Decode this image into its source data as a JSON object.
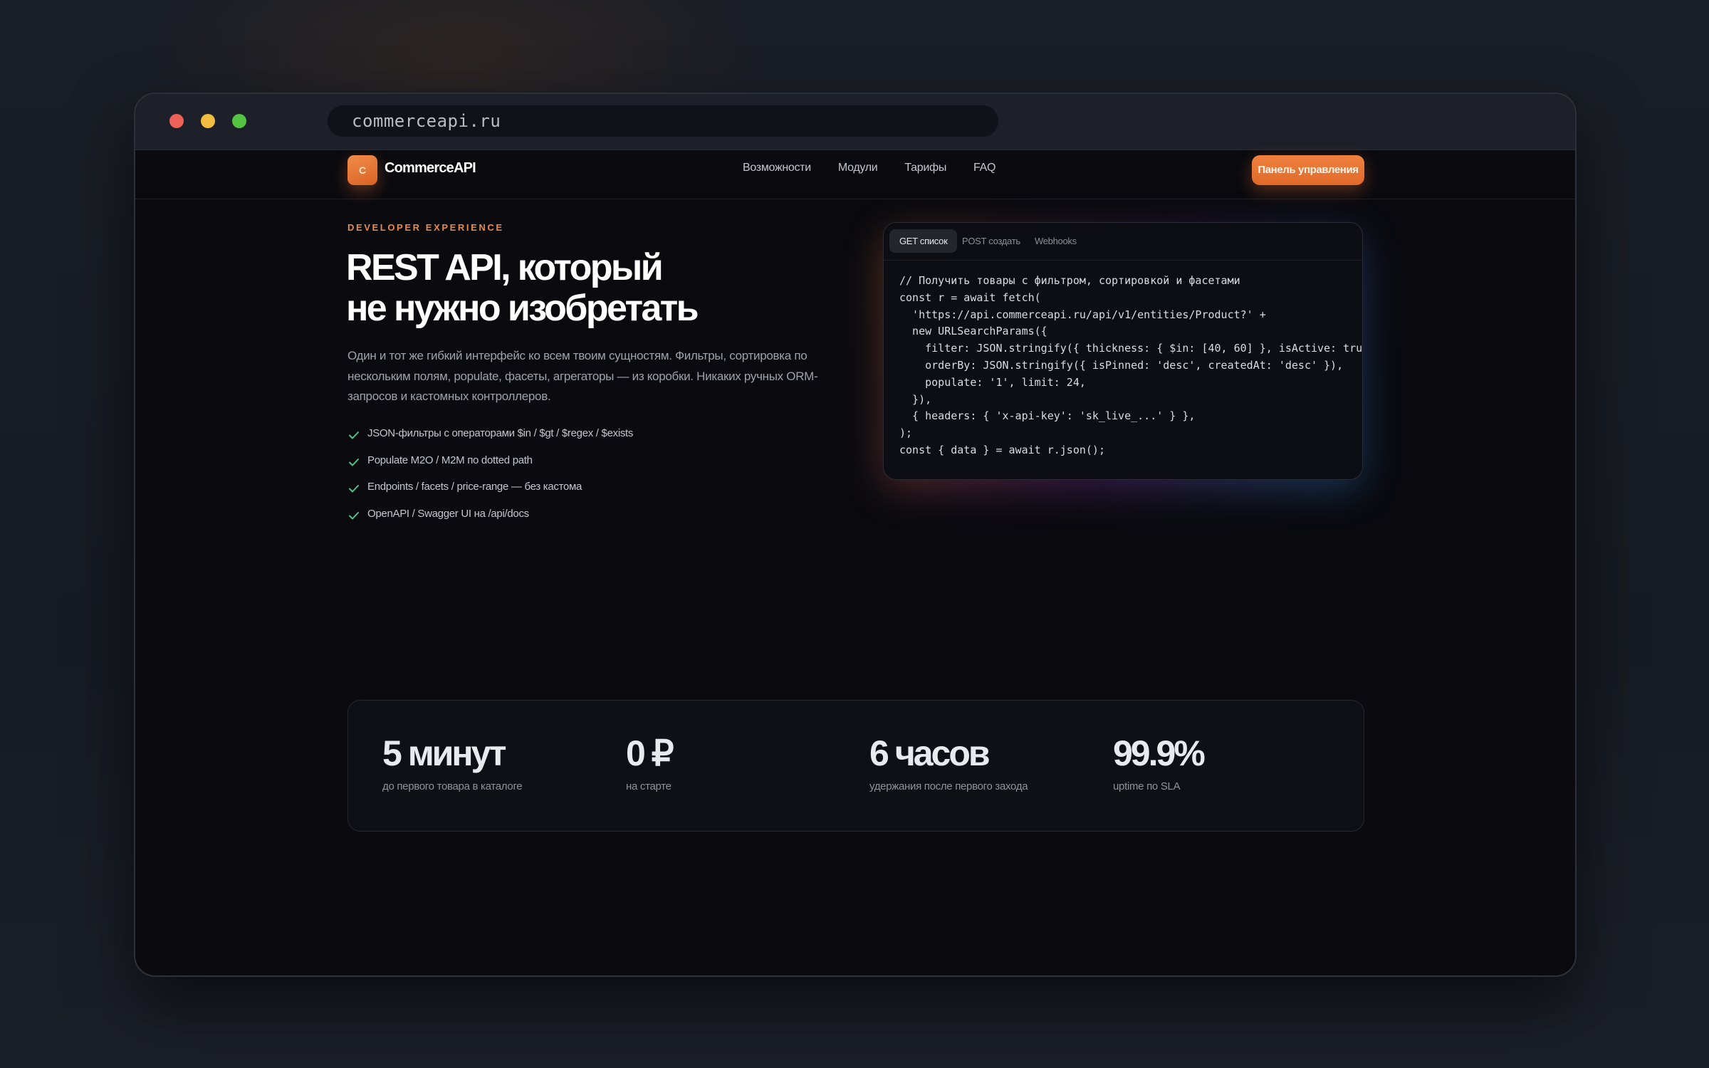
{
  "browser": {
    "url": "commerceapi.ru"
  },
  "nav": {
    "logo_letter": "C",
    "brand": "CommerceAPI",
    "links": [
      "Возможности",
      "Модули",
      "Тарифы",
      "FAQ"
    ],
    "cta": "Панель управления"
  },
  "hero": {
    "eyebrow": "DEVELOPER EXPERIENCE",
    "title_line1": "REST API, который",
    "title_line2": "не нужно изобретать",
    "lead": "Один и тот же гибкий интерфейс ко всем твоим сущностям. Фильтры, сортировка по нескольким полям, populate, фасеты, агрегаторы — из коробки. Никаких ручных ORM-запросов и кастомных контроллеров.",
    "features": [
      "JSON-фильтры с операторами $in / $gt / $regex / $exists",
      "Populate M2O / M2M по dotted path",
      "Endpoints / facets / price-range — без кастома",
      "OpenAPI / Swagger UI на /api/docs"
    ]
  },
  "code": {
    "tabs": [
      "GET список",
      "POST создать",
      "Webhooks"
    ],
    "active_tab": "GET список",
    "lines": [
      "// Получить товары с фильтром, сортировкой и фасетами",
      "const r = await fetch(",
      "  'https://api.commerceapi.ru/api/v1/entities/Product?' +",
      "  new URLSearchParams({",
      "    filter: JSON.stringify({ thickness: { $in: [40, 60] }, isActive: tru",
      "    orderBy: JSON.stringify({ isPinned: 'desc', createdAt: 'desc' }),",
      "    populate: '1', limit: 24,",
      "  }),",
      "  { headers: { 'x-api-key': 'sk_live_...' } },",
      ");",
      "const { data } = await r.json();"
    ]
  },
  "stats": [
    {
      "value": "5 минут",
      "label": "до первого товара в каталоге"
    },
    {
      "value": "0 ₽",
      "label": "на старте"
    },
    {
      "value": "6 часов",
      "label": "удержания после первого захода"
    },
    {
      "value": "99.9%",
      "label": "uptime по SLA"
    }
  ],
  "colors": {
    "accent": "#e9773a",
    "check": "#4fc488",
    "background": "#0a0a0f"
  }
}
